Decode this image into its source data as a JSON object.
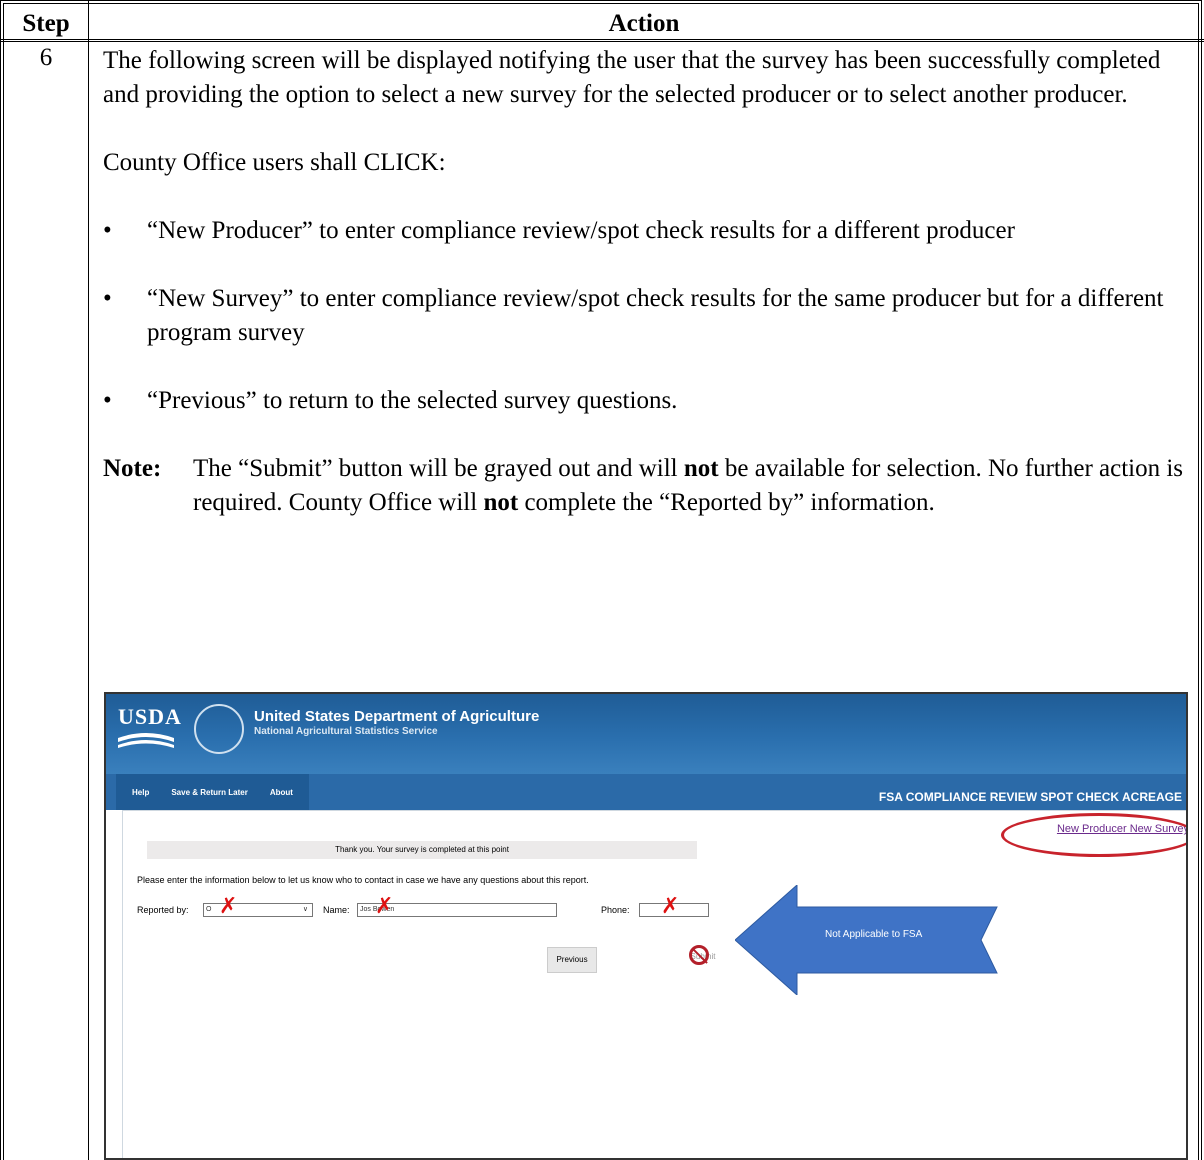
{
  "table": {
    "header_step": "Step",
    "header_action": "Action",
    "step_number": "6"
  },
  "content": {
    "paragraph1": "The following screen will be displayed notifying the user that the survey has been successfully completed and providing the option to select a new survey for the selected producer or to select another producer.",
    "paragraph2": "County Office users shall CLICK:",
    "bullet_char": "•",
    "bullets": [
      "“New Producer” to enter compliance review/spot check results for a different producer",
      "“New Survey” to enter compliance review/spot check results for the same producer but for a different program survey",
      "“Previous” to return to the selected survey questions."
    ],
    "note_label": "Note:",
    "note_part1": "The “Submit” button will be grayed out and will ",
    "note_bold1": "not",
    "note_part2": " be available for selection.  No further action is required.  County Office will ",
    "note_bold2": "not",
    "note_part3": " complete the “Reported by” information."
  },
  "screenshot": {
    "usda": "USDA",
    "org_name": "United States Department of Agriculture",
    "org_sub": "National Agricultural Statistics Service",
    "nav_tabs": [
      "Help",
      "Save & Return Later",
      "About"
    ],
    "app_title": "FSA COMPLIANCE REVIEW SPOT CHECK ACREAGE",
    "links": "New Producer  New Survey",
    "thanks": "Thank you. Your survey is completed at this point",
    "info": "Please enter the information below to let us know who to contact in case we have any questions about this report.",
    "reported_by_label": "Reported by:",
    "reported_by_value": "O",
    "name_label": "Name:",
    "name_value": "Jos      Bowen",
    "phone_label": "Phone:",
    "previous_button": "Previous",
    "submit_button": "Submit",
    "arrow_text": "Not Applicable to FSA",
    "x_mark": "✗",
    "chevron": "∨"
  }
}
